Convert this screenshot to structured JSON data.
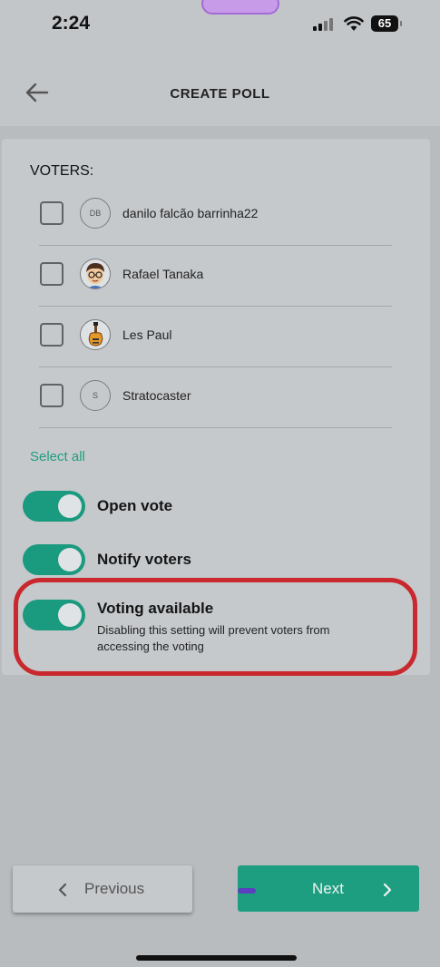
{
  "status_bar": {
    "time": "2:24",
    "battery": "65"
  },
  "header": {
    "title": "CREATE POLL"
  },
  "voters": {
    "section_title": "VOTERS:",
    "items": [
      {
        "name": "danilo falcão barrinha22",
        "initials": "DB",
        "avatar": "initials",
        "checked": false
      },
      {
        "name": "Rafael Tanaka",
        "initials": "",
        "avatar": "person-emoji-avatar",
        "checked": false
      },
      {
        "name": "Les Paul",
        "initials": "",
        "avatar": "guitar-avatar",
        "checked": false
      },
      {
        "name": "Stratocaster",
        "initials": "S",
        "avatar": "initials",
        "checked": false
      }
    ],
    "select_all": "Select all"
  },
  "settings": {
    "open_vote": {
      "label": "Open vote",
      "on": true
    },
    "notify_voters": {
      "label": "Notify voters",
      "on": true
    },
    "voting_available": {
      "label": "Voting available",
      "description": "Disabling this setting will prevent voters from accessing the voting",
      "on": true
    }
  },
  "footer": {
    "previous_label": "Previous",
    "next_label": "Next"
  },
  "colors": {
    "accent": "#1a9a7e",
    "highlight": "#c9282e",
    "background": "#b9bcbf"
  }
}
